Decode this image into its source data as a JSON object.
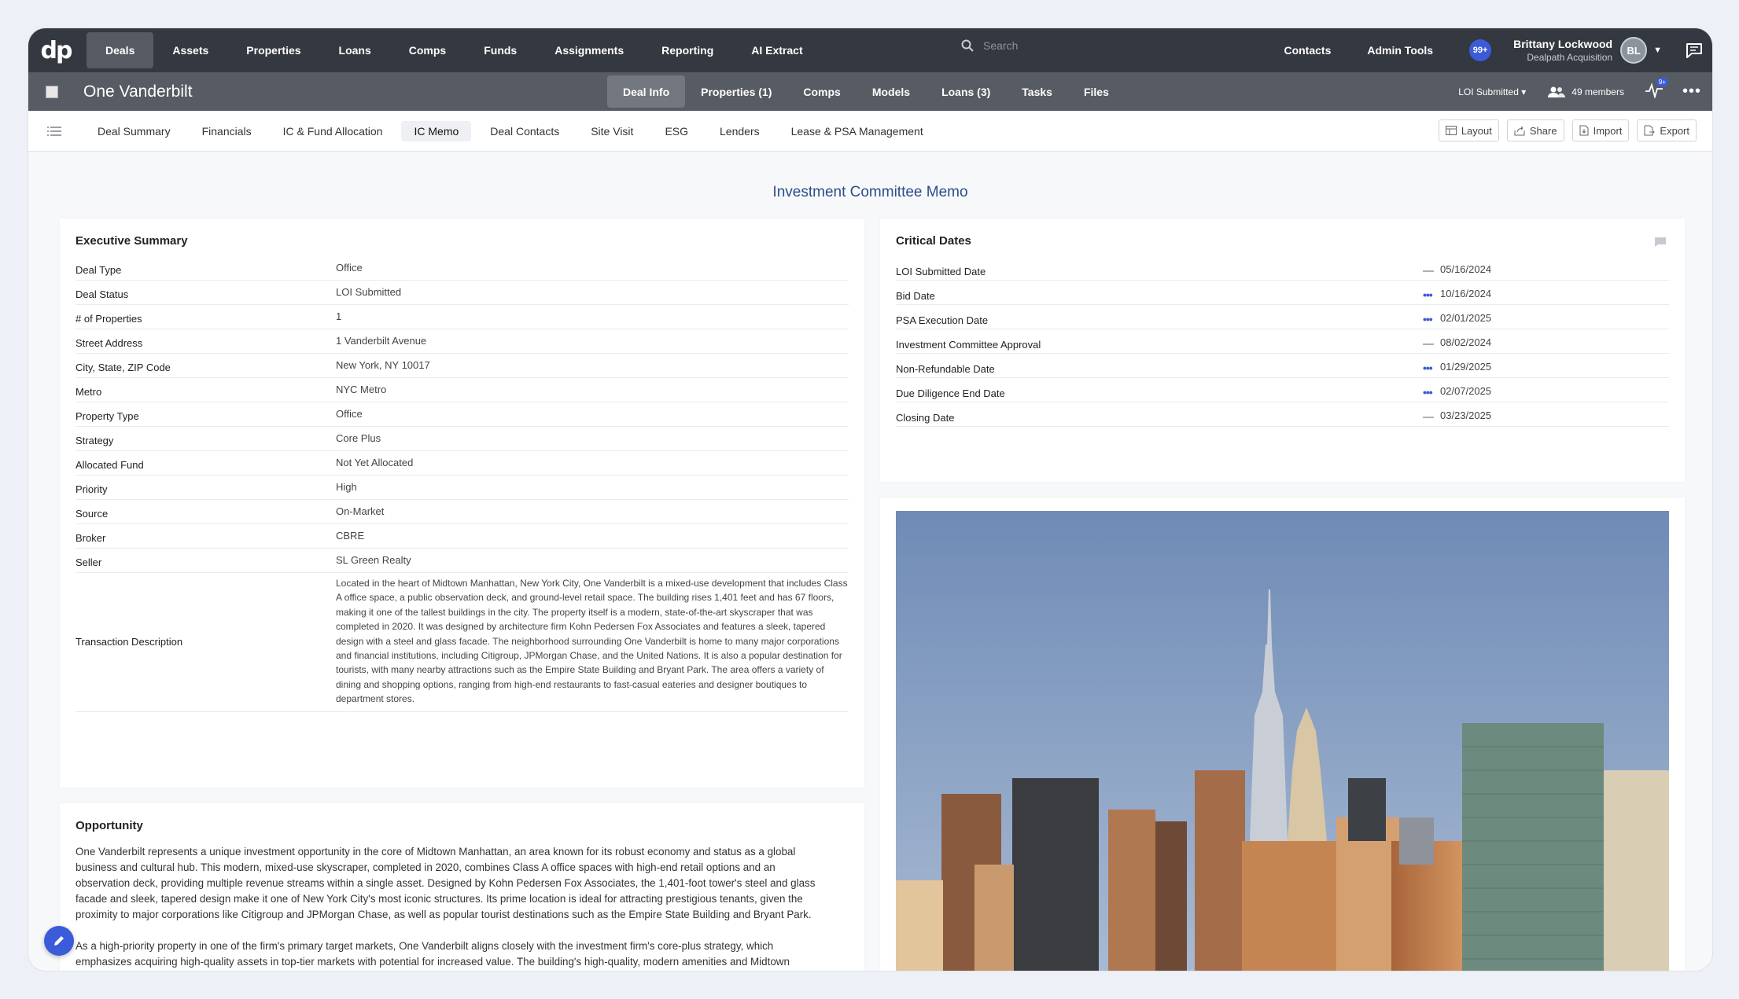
{
  "topnav": {
    "logo": "dp",
    "items": [
      "Deals",
      "Assets",
      "Properties",
      "Loans",
      "Comps",
      "Funds",
      "Assignments",
      "Reporting",
      "AI Extract"
    ],
    "search_placeholder": "Search",
    "right_links": [
      "Contacts",
      "Admin Tools"
    ],
    "notifications": "99+",
    "user_name": "Brittany Lockwood",
    "user_company": "Dealpath Acquisition",
    "user_initials": "BL"
  },
  "dealbar": {
    "title": "One Vanderbilt",
    "tabs": [
      "Deal Info",
      "Properties (1)",
      "Comps",
      "Models",
      "Loans (3)",
      "Tasks",
      "Files"
    ],
    "status": "LOI Submitted",
    "members": "49 members",
    "activity_badge": "9+"
  },
  "sections": {
    "tabs": [
      "Deal Summary",
      "Financials",
      "IC & Fund Allocation",
      "IC Memo",
      "Deal Contacts",
      "Site Visit",
      "ESG",
      "Lenders",
      "Lease & PSA Management"
    ],
    "actions": [
      "Layout",
      "Share",
      "Import",
      "Export"
    ]
  },
  "page_title": "Investment Committee Memo",
  "executive_summary": {
    "title": "Executive Summary",
    "rows": [
      {
        "label": "Deal Type",
        "value": "Office"
      },
      {
        "label": "Deal Status",
        "value": "LOI Submitted"
      },
      {
        "label": "# of Properties",
        "value": "1"
      },
      {
        "label": "Street Address",
        "value": "1 Vanderbilt Avenue"
      },
      {
        "label": "City, State, ZIP Code",
        "value": "New York, NY 10017"
      },
      {
        "label": "Metro",
        "value": "NYC Metro"
      },
      {
        "label": "Property Type",
        "value": "Office"
      },
      {
        "label": "Strategy",
        "value": "Core Plus"
      },
      {
        "label": "Allocated Fund",
        "value": "Not Yet Allocated"
      },
      {
        "label": "Priority",
        "value": "High"
      },
      {
        "label": "Source",
        "value": "On-Market"
      },
      {
        "label": "Broker",
        "value": "CBRE"
      },
      {
        "label": "Seller",
        "value": "SL Green Realty"
      }
    ],
    "transaction_label": "Transaction Description",
    "transaction_text": "Located in the heart of Midtown Manhattan, New York City, One Vanderbilt is a mixed-use development that includes Class A office space, a public observation deck, and ground-level retail space. The building rises 1,401 feet and has 67 floors, making it one of the tallest buildings in the city. The property itself is a modern, state-of-the-art skyscraper that was completed in 2020. It was designed by architecture firm Kohn Pedersen Fox Associates and features a sleek, tapered design with a steel and glass facade. The neighborhood surrounding One Vanderbilt is home to many major corporations and financial institutions, including Citigroup, JPMorgan Chase, and the United Nations. It is also a popular destination for tourists, with many nearby attractions such as the Empire State Building and Bryant Park. The area offers a variety of dining and shopping options, ranging from high-end restaurants to fast-casual eateries and designer boutiques to department stores."
  },
  "critical_dates": {
    "title": "Critical Dates",
    "rows": [
      {
        "label": "LOI Submitted Date",
        "value": "05/16/2024",
        "icon": "dash"
      },
      {
        "label": "Bid Date",
        "value": "10/16/2024",
        "icon": "dots"
      },
      {
        "label": "PSA Execution Date",
        "value": "02/01/2025",
        "icon": "dots"
      },
      {
        "label": "Investment Committee Approval",
        "value": "08/02/2024",
        "icon": "dash"
      },
      {
        "label": "Non-Refundable Date",
        "value": "01/29/2025",
        "icon": "dots"
      },
      {
        "label": "Due Diligence End Date",
        "value": "02/07/2025",
        "icon": "dots"
      },
      {
        "label": "Closing Date",
        "value": "03/23/2025",
        "icon": "dash"
      }
    ]
  },
  "opportunity": {
    "title": "Opportunity",
    "p1": "One Vanderbilt represents a unique investment opportunity in the core of Midtown Manhattan, an area known for its robust economy and status as a global business and cultural hub. This modern, mixed-use skyscraper, completed in 2020, combines Class A office spaces with high-end retail options and an observation deck, providing multiple revenue streams within a single asset. Designed by Kohn Pedersen Fox Associates, the 1,401-foot tower's steel and glass facade and sleek, tapered design make it one of New York City's most iconic structures. Its prime location is ideal for attracting prestigious tenants, given the proximity to major corporations like Citigroup and JPMorgan Chase, as well as popular tourist destinations such as the Empire State Building and Bryant Park.",
    "p2": "As a high-priority property in one of the firm's primary target markets, One Vanderbilt aligns closely with the investment firm's core-plus strategy, which emphasizes acquiring high-quality assets in top-tier markets with potential for increased value. The building's high-quality, modern amenities and Midtown Manhattan's continued economic vitality make it well positioned for steady income generation and potential appreciation. With its"
  },
  "colors": {
    "topnav_bg": "#343840",
    "dealbar_bg": "#575b63",
    "accent": "#3c5bd8",
    "title_blue": "#2c4d8a"
  }
}
